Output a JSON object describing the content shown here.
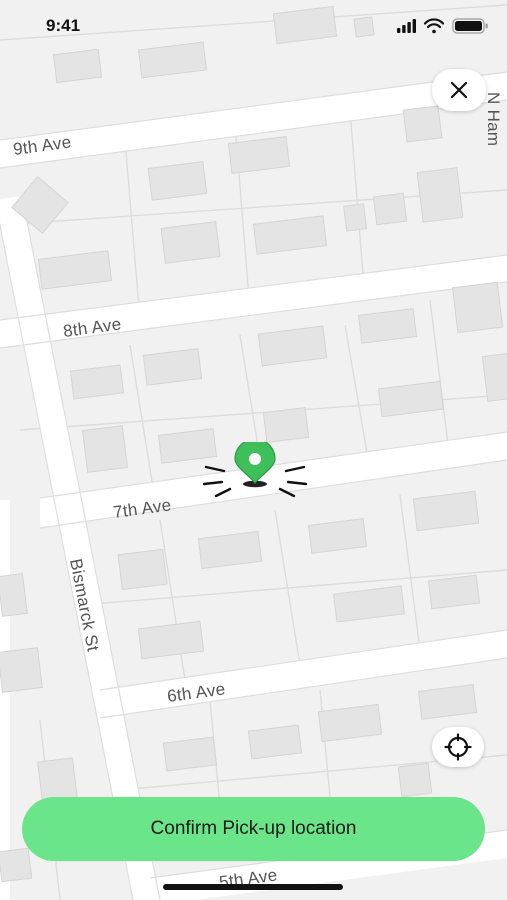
{
  "status_bar": {
    "time": "9:41",
    "icons": [
      "cellular-signal-icon",
      "wifi-icon",
      "battery-icon"
    ]
  },
  "map": {
    "streets": {
      "ninth": "9th Ave",
      "eighth": "8th Ave",
      "seventh": "7th Ave",
      "sixth": "6th Ave",
      "fifth": "5th Ave",
      "bismarck": "Bismarck St",
      "n_ham": "N Ham"
    },
    "pin_color": "#3fbf5a"
  },
  "controls": {
    "close_icon": "close-icon",
    "locate_icon": "locate-me-icon"
  },
  "confirm": {
    "label": "Confirm Pick-up location",
    "color": "#6be589"
  }
}
